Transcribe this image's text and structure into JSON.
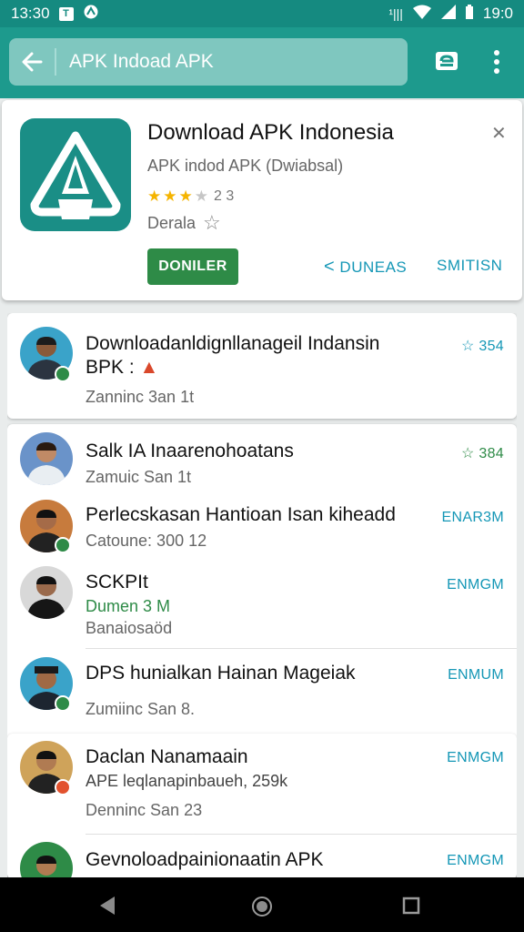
{
  "status_bar": {
    "time": "13:30",
    "box_label": "T",
    "circle_label": "D",
    "right_label": "¹|||",
    "battery": "19:0"
  },
  "search": {
    "text": "APK Indoad APK"
  },
  "app": {
    "title": "Download APK Indonesia",
    "subtitle": "APK indod APK (Dwiabsal)",
    "rating_count": "2 3",
    "developer": "Derala",
    "install_label": "DONILER",
    "link_1": "DUNEAS",
    "link_2": "SMITISN"
  },
  "items": [
    {
      "title_1": "Downloadanldignllanageil Indansin",
      "title_2": "BPK :",
      "meta": "Zanninc 3an 1t",
      "right": "☆ 354"
    },
    {
      "title_1": "Salk IA Inaarenohoatans",
      "meta": "Zamuic San 1t",
      "right": "☆ 384"
    },
    {
      "title_1": "Perlecskasan Hantioan Isan kiheadd",
      "meta": "Catoune: 300 12",
      "right": "ENAR3M"
    },
    {
      "title_1": "SCKPIt",
      "green": "Dumen 3 M",
      "meta": "Banaiosaöd",
      "right": "ENMGM"
    },
    {
      "title_1": "DPS hunialkan Hainan Mageiak",
      "meta": "Zumiinc San 8.",
      "right": "ENMUM"
    },
    {
      "title_1": "Daclan Nanamaain",
      "meta_2": "APE leqlanapinbaueh, 259k",
      "meta": "Denninc San 23",
      "right": "ENMGM"
    },
    {
      "title_1": "Gevnoloadpainionaatin APK",
      "right": "ENMGM"
    }
  ],
  "colors": {
    "appbar": "#1d9a8d",
    "statusbar": "#158a80",
    "install": "#2e8b47",
    "link": "#1597b6"
  }
}
